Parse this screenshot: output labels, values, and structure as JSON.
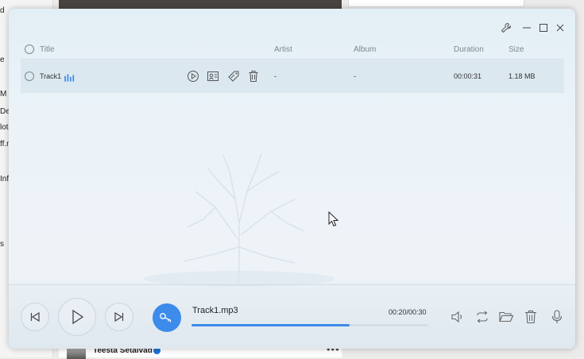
{
  "background": {
    "left_fragments": [
      "d",
      "e",
      "M",
      "De",
      "lote",
      "ff.n",
      "Inf",
      "s"
    ],
    "bottom_post_name": "Teesta Setalvad",
    "more_label": "•••"
  },
  "player": {
    "window_buttons": {
      "settings_icon": "wrench-icon",
      "minimize_icon": "minimize-icon",
      "maximize_icon": "maximize-icon",
      "close_icon": "close-icon"
    },
    "columns": {
      "title": "Title",
      "artist": "Artist",
      "album": "Album",
      "duration": "Duration",
      "size": "Size"
    },
    "tracks": [
      {
        "title": "Track1",
        "artist": "-",
        "album": "-",
        "duration": "00:00:31",
        "size": "1.18 MB"
      }
    ],
    "now_playing": {
      "file_name": "Track1.mp3",
      "time": "00:20/00:30",
      "progress": 0.667
    },
    "colors": {
      "accent": "#3d8bea",
      "text": "#333333",
      "header_text": "#7b8790"
    }
  }
}
